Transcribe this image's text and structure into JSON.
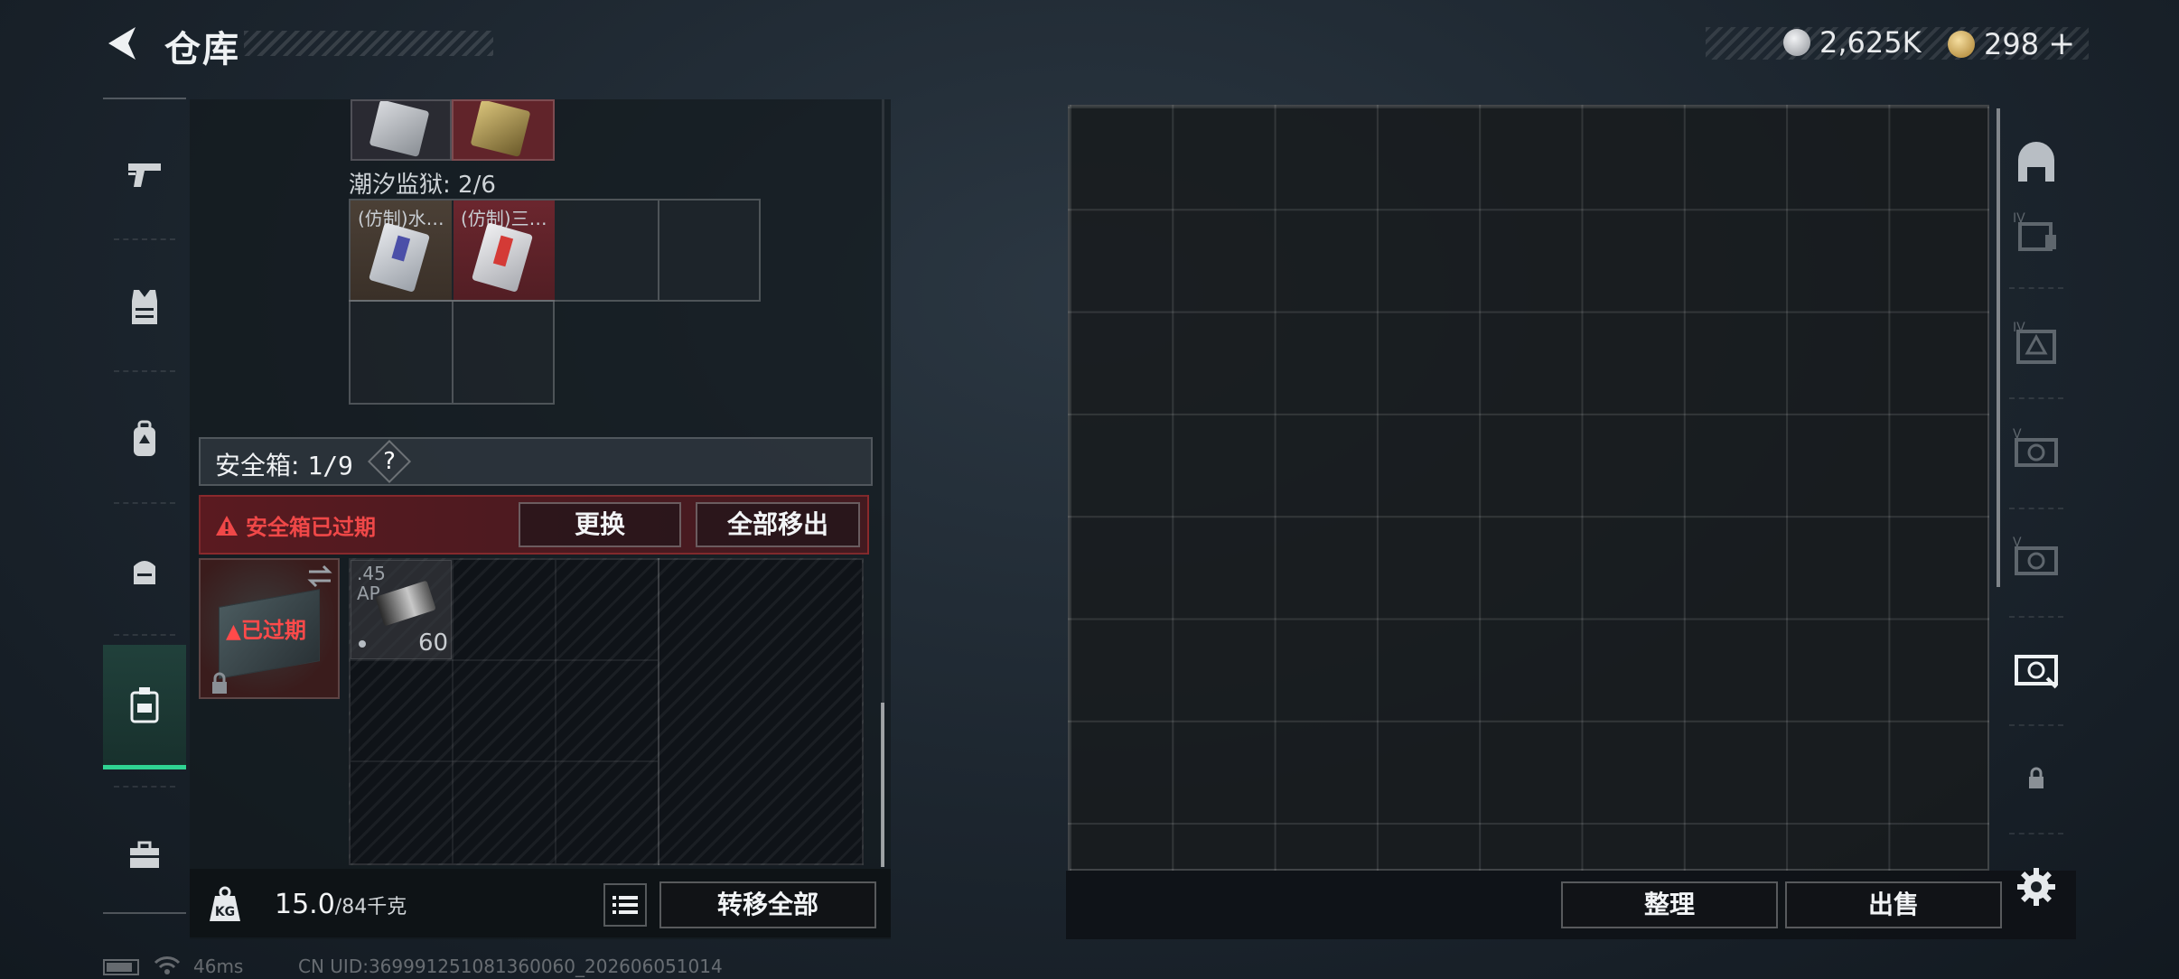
{
  "header": {
    "title": "仓库",
    "currency": [
      {
        "name": "silver",
        "value": "2,625K",
        "color": "#c9ccd0"
      },
      {
        "name": "gold",
        "value": "298",
        "color": "#c8a24e"
      }
    ],
    "add_label": "+"
  },
  "left_rail": {
    "items": [
      "pistol-icon",
      "armor-vest-icon",
      "backpack-icon",
      "chest-rig-icon",
      "safebox-icon",
      "toolbox-icon"
    ],
    "active_index": 4
  },
  "containers": {
    "section_label": "潮汐监狱: 2/6",
    "items": [
      {
        "tag": "(仿制)水…"
      },
      {
        "tag": "(仿制)三…"
      }
    ]
  },
  "safebox": {
    "label": "安全箱:",
    "capacity": "1/9",
    "help": "?",
    "expired_warning": "安全箱已过期",
    "replace_button": "更换",
    "remove_all_button": "全部移出",
    "case_status": "已过期",
    "ammo": {
      "caliber": ".45",
      "type": "AP",
      "count": "60"
    }
  },
  "bottom_left": {
    "kg_label": "KG",
    "weight_current": "15.0",
    "weight_max": "/84千克",
    "transfer_all_button": "转移全部"
  },
  "stash": {
    "sort_button": "整理",
    "sell_button": "出售"
  },
  "status_bar": {
    "ping": "46ms",
    "uid": "CN UID:369991251081360060_202606051014"
  },
  "colors": {
    "accent_green": "#2fd392",
    "warning_red": "#f04848",
    "gold": "#c8a24e"
  }
}
